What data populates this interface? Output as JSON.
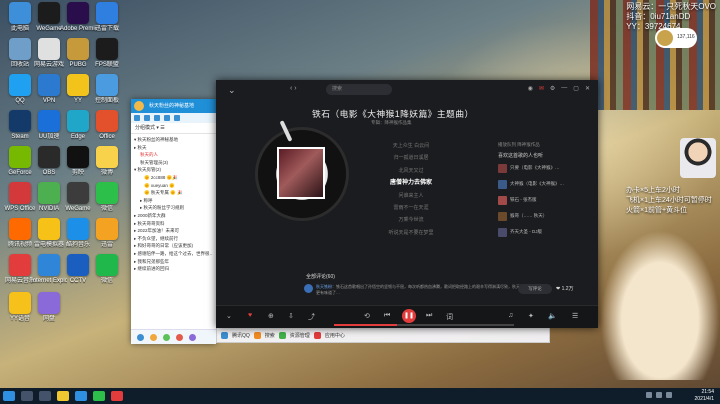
{
  "overlay": {
    "lines": [
      "网易云：一只死秋天OVO",
      "抖音：0iu71anDD",
      "YY：39724674"
    ],
    "stream_lines": [
      "办卡×5上车2小时",
      "飞机×1上车24小时可暂停时",
      "火箭×1前管+黄斗位"
    ],
    "badge": "137,116"
  },
  "desktop_icons": [
    {
      "label": "此电脑",
      "color": "#3d8fd9"
    },
    {
      "label": "WeGame",
      "color": "#1c1c1c"
    },
    {
      "label": "Adobe Premiere",
      "color": "#2a0e4b"
    },
    {
      "label": "迅雷下载",
      "color": "#2f7fe0"
    },
    {
      "label": "回收站",
      "color": "#6f9fc9"
    },
    {
      "label": "网易云游戏",
      "color": "#e0e0e0"
    },
    {
      "label": "PUBG",
      "color": "#c69a3a"
    },
    {
      "label": "FPS联盟",
      "color": "#1c1c1c"
    },
    {
      "label": "QQ",
      "color": "#20a0f0"
    },
    {
      "label": "VPN",
      "color": "#2b7ad0"
    },
    {
      "label": "YY",
      "color": "#f2c41b"
    },
    {
      "label": "控制面板",
      "color": "#4a9be0"
    },
    {
      "label": "Steam",
      "color": "#143a6a"
    },
    {
      "label": "UU加速",
      "color": "#1a6fd8"
    },
    {
      "label": "Edge",
      "color": "#1fa6c9"
    },
    {
      "label": "Office",
      "color": "#e2512c"
    },
    {
      "label": "GeForce",
      "color": "#76b900"
    },
    {
      "label": "OBS",
      "color": "#2a2a2a"
    },
    {
      "label": "剪映",
      "color": "#111111"
    },
    {
      "label": "微博",
      "color": "#f8d24a"
    },
    {
      "label": "WPS Office",
      "color": "#d3383b"
    },
    {
      "label": "NVIDIA",
      "color": "#4caf50"
    },
    {
      "label": "WeGame",
      "color": "#3c3c3c"
    },
    {
      "label": "微信",
      "color": "#2cc04a"
    },
    {
      "label": "腾讯视频",
      "color": "#ff6a00"
    },
    {
      "label": "雷电模拟器",
      "color": "#f6c218"
    },
    {
      "label": "酷狗音乐",
      "color": "#1c8fe8"
    },
    {
      "label": "迅雷",
      "color": "#f3a321"
    },
    {
      "label": "网易云音乐",
      "color": "#e23c3c"
    },
    {
      "label": "Internet Explorer",
      "color": "#2f85d8"
    },
    {
      "label": "CCTV",
      "color": "#1a5fc0"
    },
    {
      "label": "微信",
      "color": "#20b84a"
    },
    {
      "label": "YY语音",
      "color": "#f5c11a"
    },
    {
      "label": "网盘",
      "color": "#8a6ad8"
    }
  ],
  "qq": {
    "title": "秋天粉丝的神秘基地",
    "toolbar": "分组模式  ▾ ☰",
    "rows": [
      {
        "text": "▾ 秋天粉丝的神秘基地",
        "cls": ""
      },
      {
        "text": "▸ 秋天",
        "cls": ""
      },
      {
        "text": "秋天的人",
        "cls": "ind hl"
      },
      {
        "text": "秋天管理员(3)",
        "cls": "ind"
      },
      {
        "text": "▾ 秋天房管(2)",
        "cls": ""
      },
      {
        "text": "🌞 2cc888 🌞🎉",
        "cls": "ind2"
      },
      {
        "text": "🌞 xueyuan 🌞",
        "cls": "ind2"
      },
      {
        "text": "🌞 秋天专属 🌞 🎉",
        "cls": "ind2"
      },
      {
        "text": "▸ 称呼",
        "cls": "ind"
      },
      {
        "text": "▸ 秋天的粉丝学习规则",
        "cls": "ind"
      },
      {
        "text": "▸ 2000新年大群",
        "cls": ""
      },
      {
        "text": "▸ 秋天哥哥资料",
        "cls": ""
      },
      {
        "text": "▸ 2022年加油！未来可",
        "cls": ""
      },
      {
        "text": "▸ 不负众望，继续前行",
        "cls": ""
      },
      {
        "text": "▸ 和好哥哥的日常（应该更加)",
        "cls": ""
      },
      {
        "text": "▸ 感谢陪伴一路，给这个过去，世界很…",
        "cls": ""
      },
      {
        "text": "▸ 我和兄弟那些年",
        "cls": ""
      },
      {
        "text": "▸ 继续前进的回归",
        "cls": ""
      }
    ]
  },
  "strip": {
    "a": "腾讯QQ",
    "b": "搜索",
    "c": "资源管理",
    "d": "应用中心"
  },
  "player": {
    "search_placeholder": "搜索",
    "song_title": "铁石（电影《大神猴1降妖篇》主题曲）",
    "meta": "专辑：降神猴作品集",
    "lyrics": [
      "天上众生 白云间",
      "归一孤道日溪居",
      "北风天又过",
      "唐僧神力去佛家",
      "问谁来主人",
      "雷雨不一在天涯",
      "万乘今世流",
      "听说天是不要在梦里"
    ],
    "current_lyric_index": 3,
    "right_head": "播放队列  降神猴作品",
    "right_title": "喜欢这首歌的人也听",
    "similar": [
      {
        "title": "只要（电影《大神猴》…",
        "color": "#7a3a3a"
      },
      {
        "title": "大神猴（电影《大神猴》…",
        "color": "#3a5a8a"
      },
      {
        "title": "铁石 - 张杰版",
        "color": "#a24a4a"
      },
      {
        "title": "猴哥（…… 秋天）",
        "color": "#6a4a2a"
      },
      {
        "title": "齐天大圣 - DJ版",
        "color": "#4a4a6a"
      }
    ],
    "comments_header": "全部评论(60)",
    "comment_user": "秋天铁粉",
    "comment_text": "：铁石这首歌唱出了孙悟空的坚韧与不屈，每次听都热血沸腾，歌词把取经路上的艰辛写得淋漓尽致，秋天翻唱得更有味道了…",
    "write_comment": "写评论",
    "like_count": "1.2万",
    "progress": 0.35
  },
  "taskbar": {
    "time": "21:54",
    "date": "2021/4/1"
  }
}
